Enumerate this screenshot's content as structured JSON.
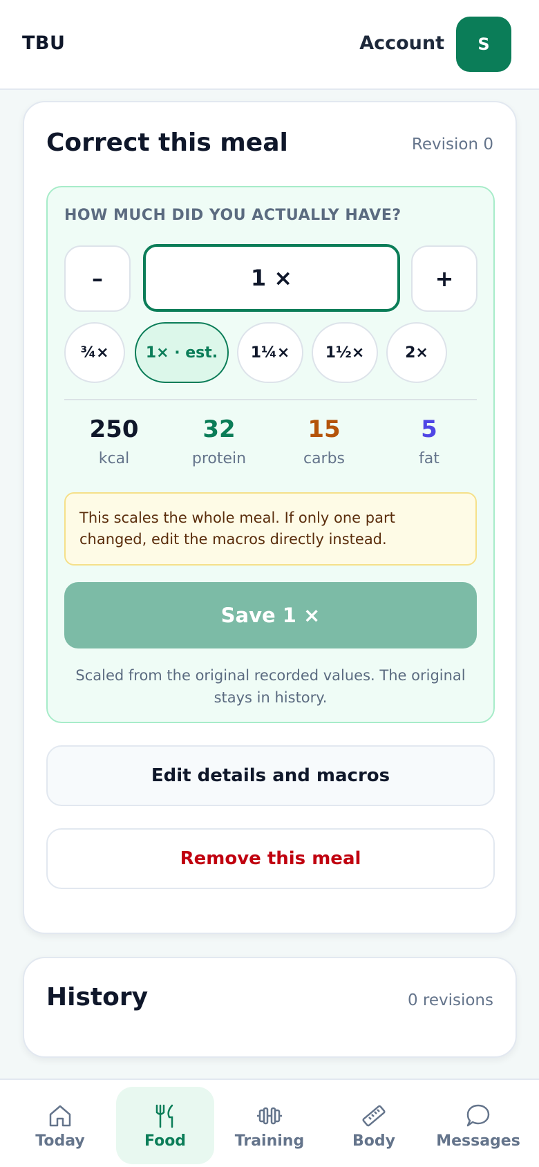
{
  "header": {
    "brand": "TBU",
    "account_label": "Account",
    "avatar_initial": "S"
  },
  "correction": {
    "title": "Correct this meal",
    "revision": "Revision 0",
    "question": "HOW MUCH DID YOU ACTUALLY HAVE?",
    "decrement_label": "–",
    "increment_label": "+",
    "quantity": "1 ×",
    "presets": [
      {
        "label": "¾×",
        "selected": false
      },
      {
        "label": "1× · est.",
        "selected": true
      },
      {
        "label": "1¼×",
        "selected": false
      },
      {
        "label": "1½×",
        "selected": false
      },
      {
        "label": "2×",
        "selected": false
      }
    ],
    "macros": [
      {
        "value": "250",
        "label": "kcal",
        "color": "#0f172a"
      },
      {
        "value": "32",
        "label": "protein",
        "color": "#0b7d58"
      },
      {
        "value": "15",
        "label": "carbs",
        "color": "#b45309"
      },
      {
        "value": "5",
        "label": "fat",
        "color": "#4f46e5"
      }
    ],
    "notice": "This scales the whole meal. If only one part changed, edit the macros directly instead.",
    "save_label": "Save 1 ×",
    "save_note": "Scaled from the original recorded values. The original stays in history.",
    "edit_label": "Edit details and macros",
    "remove_label": "Remove this meal"
  },
  "history": {
    "title": "History",
    "count": "0 revisions"
  },
  "nav": {
    "items": [
      {
        "label": "Today",
        "icon": "home-icon",
        "active": false
      },
      {
        "label": "Food",
        "icon": "fork-knife-icon",
        "active": true
      },
      {
        "label": "Training",
        "icon": "dumbbell-icon",
        "active": false
      },
      {
        "label": "Body",
        "icon": "ruler-icon",
        "active": false
      },
      {
        "label": "Messages",
        "icon": "chat-bubble-icon",
        "active": false
      }
    ]
  },
  "colors": {
    "accent": "#0b7d58",
    "save_button": "#7cbba6",
    "danger": "#c0000f"
  }
}
